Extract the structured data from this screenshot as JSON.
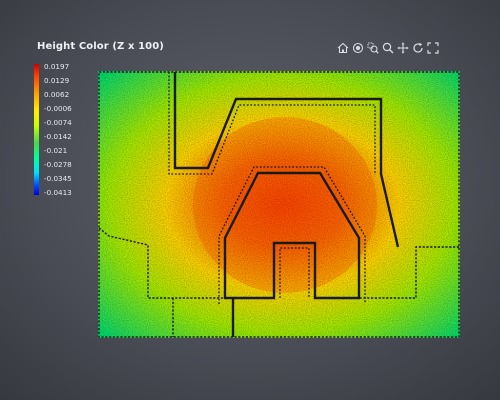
{
  "panel": {
    "title": "Height Color (Z x 100)"
  },
  "toolbar": {
    "tools": [
      {
        "name": "home-icon",
        "label": "Home"
      },
      {
        "name": "view-icon",
        "label": "View"
      },
      {
        "name": "zoom-area-icon",
        "label": "Zoom area"
      },
      {
        "name": "zoom-icon",
        "label": "Zoom"
      },
      {
        "name": "pan-icon",
        "label": "Pan"
      },
      {
        "name": "rotate-icon",
        "label": "Rotate"
      },
      {
        "name": "fullscreen-icon",
        "label": "Fullscreen"
      }
    ]
  },
  "legend": {
    "labels": [
      "0.0197",
      "0.0129",
      "0.0062",
      "-0.0006",
      "-0.0074",
      "-0.0142",
      "-0.021",
      "-0.0278",
      "-0.0345",
      "-0.0413"
    ],
    "colors": [
      "#cc0000",
      "#ff3a00",
      "#ff9d00",
      "#ffee00",
      "#c8ff00",
      "#4cd64c",
      "#00ff9c",
      "#00e0ff",
      "#0055ff",
      "#0000d5"
    ]
  },
  "plot": {
    "type": "height-color point cloud",
    "field_colors": {
      "outer": "#00d96e",
      "mid": "#a5ea00",
      "warm": "#ffd400",
      "hot": "#ff6a00",
      "core": "#ff3a00"
    },
    "outline_color": "#1a1a1a"
  }
}
